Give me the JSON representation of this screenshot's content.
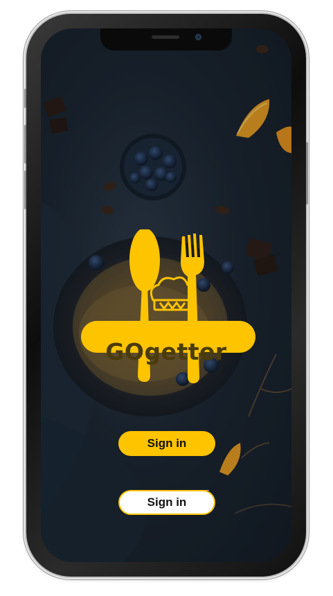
{
  "app": {
    "logo_text": "GOgetter",
    "logo_color": "#FFC400"
  },
  "actions": {
    "primary_label": "Sign in",
    "secondary_label": "Sign in"
  },
  "colors": {
    "accent": "#FFC400",
    "background": "#1b2530"
  }
}
